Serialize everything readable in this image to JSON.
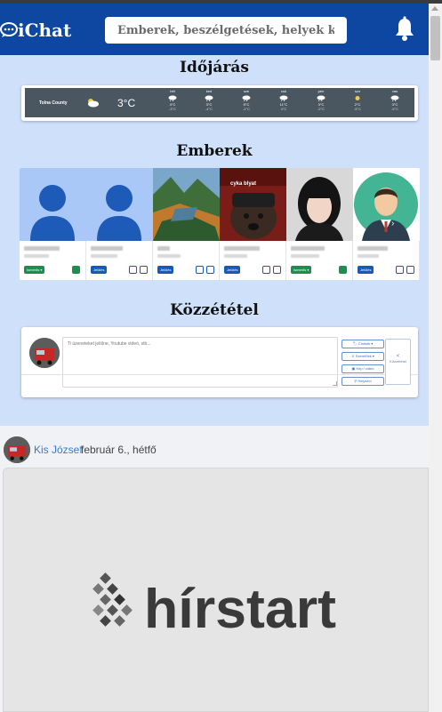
{
  "app": {
    "name": "iChat"
  },
  "header": {
    "search_placeholder": "Emberek, beszélgetések, helyek keresése"
  },
  "weather": {
    "title": "Időjárás",
    "location": "Tolna County",
    "current_temp": "3°C",
    "condition_icon": "cloudy-sun-icon",
    "forecast": [
      {
        "day": "hét",
        "icon": "rain-icon",
        "high": "4°C",
        "low": "-3°C"
      },
      {
        "day": "ked",
        "icon": "rain-icon",
        "high": "3°C",
        "low": "-4°C"
      },
      {
        "day": "sze",
        "icon": "rain-icon",
        "high": "5°C",
        "low": "-1°C"
      },
      {
        "day": "csü",
        "icon": "rain-icon",
        "high": "11°C",
        "low": "4°C"
      },
      {
        "day": "pén",
        "icon": "rain-icon",
        "high": "3°C",
        "low": "-2°C"
      },
      {
        "day": "szo",
        "icon": "sun-icon",
        "high": "2°C",
        "low": "-5°C"
      },
      {
        "day": "vas",
        "icon": "rain-icon",
        "high": "3°C",
        "low": "-5°C"
      }
    ]
  },
  "people": {
    "title": "Emberek",
    "cards": [
      {
        "photo": "default-avatar",
        "button": "Ismerős",
        "button_style": "green"
      },
      {
        "photo": "default-avatar",
        "button": "Jelölés",
        "button_style": "blue"
      },
      {
        "photo": "fjord-landscape",
        "button": "Jelölés",
        "button_style": "blue"
      },
      {
        "photo": "dog-hat",
        "photo_caption": "cyka blyat",
        "button": "Jelölés",
        "button_style": "blue"
      },
      {
        "photo": "woman-portrait",
        "button": "Ismerős",
        "button_style": "green"
      },
      {
        "photo": "man-illustration",
        "button": "Jelölés",
        "button_style": "blue"
      }
    ]
  },
  "composer": {
    "title": "Közzététel",
    "placeholder": "Ti üzeneteket jelölne, Youtube videó, stb...",
    "buttons": {
      "tag": "Címkék",
      "feeling": "Szeretőek",
      "media": "Kép / videó",
      "location": "Helyszín",
      "share": "Közzététel"
    }
  },
  "feed": [
    {
      "author": "Kis József",
      "date": "február 6., hétfő",
      "image_text": "hírstart"
    }
  ],
  "colors": {
    "navbar": "#0d47a1",
    "accent": "#3c78c9",
    "green": "#1e8e4e",
    "blue": "#1659b7"
  }
}
